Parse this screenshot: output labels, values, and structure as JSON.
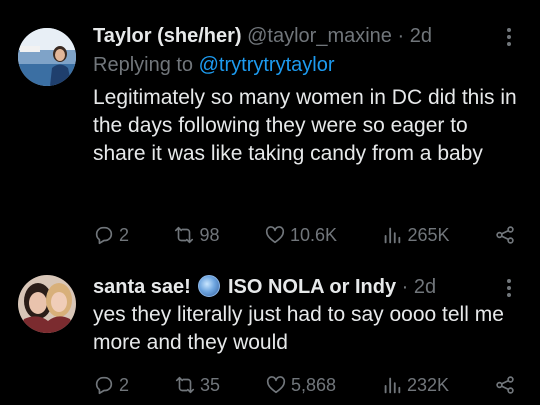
{
  "tweets": [
    {
      "name": "Taylor (she/her)",
      "handle": "@taylor_maxine",
      "separator": "·",
      "time": "2d",
      "replying_prefix": "Replying to ",
      "replying_to": "@trytrytrytaylor",
      "text": "Legitimately so many women in DC did this in the days following they were so eager to share it was like taking candy from a baby",
      "replies": "2",
      "retweets": "98",
      "likes": "10.6K",
      "views": "265K"
    },
    {
      "name_prefix": "santa sae! ",
      "name_suffix": " ISO NOLA or Indy",
      "handle": "",
      "separator": "·",
      "time": "2d",
      "text": "yes they literally just had to say oooo tell me more and they would",
      "replies": "2",
      "retweets": "35",
      "likes": "5,868",
      "views": "232K"
    }
  ],
  "icons": [
    "reply-icon",
    "retweet-icon",
    "like-icon",
    "views-icon",
    "share-icon",
    "more-icon"
  ],
  "colors": {
    "background": "#000000",
    "text": "#e7e9ea",
    "muted": "#71767b",
    "link": "#1d9bf0"
  }
}
